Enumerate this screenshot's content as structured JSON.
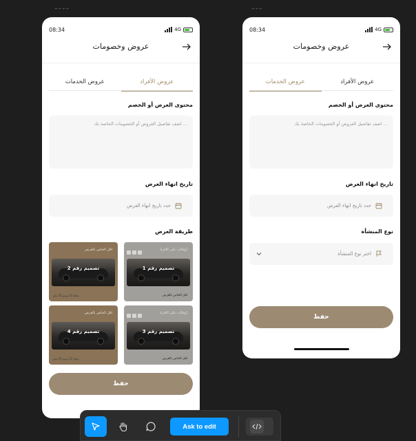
{
  "frames": {
    "left_label": "ـ ـ ـ ـ",
    "right_label": "ـ ـ ـ"
  },
  "status": {
    "time": "08:34",
    "network": "4G"
  },
  "left_phone": {
    "title": "عروض وخصومات",
    "tabs": [
      "عروض الخدمات",
      "عروض الأفراد"
    ],
    "active_tab": "عروض الأفراد",
    "content_label": "محتوى العرض أو الخصم",
    "content_placeholder": "اضف تفاصيل العروض أو الخصومات الخاصة بك ...",
    "end_date_label": "تاريخ انهاء العرض",
    "end_date_placeholder": "حدد تاريخ انهاء العرض",
    "method_label": "طريقة العرض",
    "designs": [
      {
        "name": "تصميم رقم 1",
        "top": "اوفكات على الافراد",
        "bottom": "اقل الخاص بالعرض",
        "style": "gray"
      },
      {
        "name": "تصميم رقم 2",
        "top": "اقل الخاص بالعرض",
        "bottom": "صالح 12 يونيو 25 مايو",
        "style": "brown"
      },
      {
        "name": "تصميم رقم 3",
        "top": "اوفكات على الافراد",
        "bottom": "اقل الخاص بالعرض",
        "style": "gray"
      },
      {
        "name": "تصميم رقم 4",
        "top": "اقل الخاص بالعرض",
        "bottom": "صالح 12 يونيو 25 مايو",
        "style": "brown"
      }
    ],
    "save_label": "حفظ"
  },
  "right_phone": {
    "title": "عروض وخصومات",
    "tabs": [
      "عروض الخدمات",
      "عروض الأفراد"
    ],
    "active_tab": "عروض الخدمات",
    "content_label": "محتوى العرض أو الخصم",
    "content_placeholder": "اضف تفاصيل العروض أو الخصومات الخاصة بك ...",
    "end_date_label": "تاريخ انهاء العرض",
    "end_date_placeholder": "حدد تاريخ انهاء العرض",
    "facility_label": "نوع المنشأة",
    "facility_placeholder": "اختر نوع المنشأة",
    "save_label": "حفظ"
  },
  "toolbar": {
    "ask_label": "Ask to edit",
    "tools": [
      "move-icon",
      "hand-icon",
      "comment-icon",
      "code-icon"
    ],
    "accent": "#0d99ff"
  },
  "colors": {
    "brand": "#9d8a72",
    "tab_active": "#a08a6b"
  }
}
